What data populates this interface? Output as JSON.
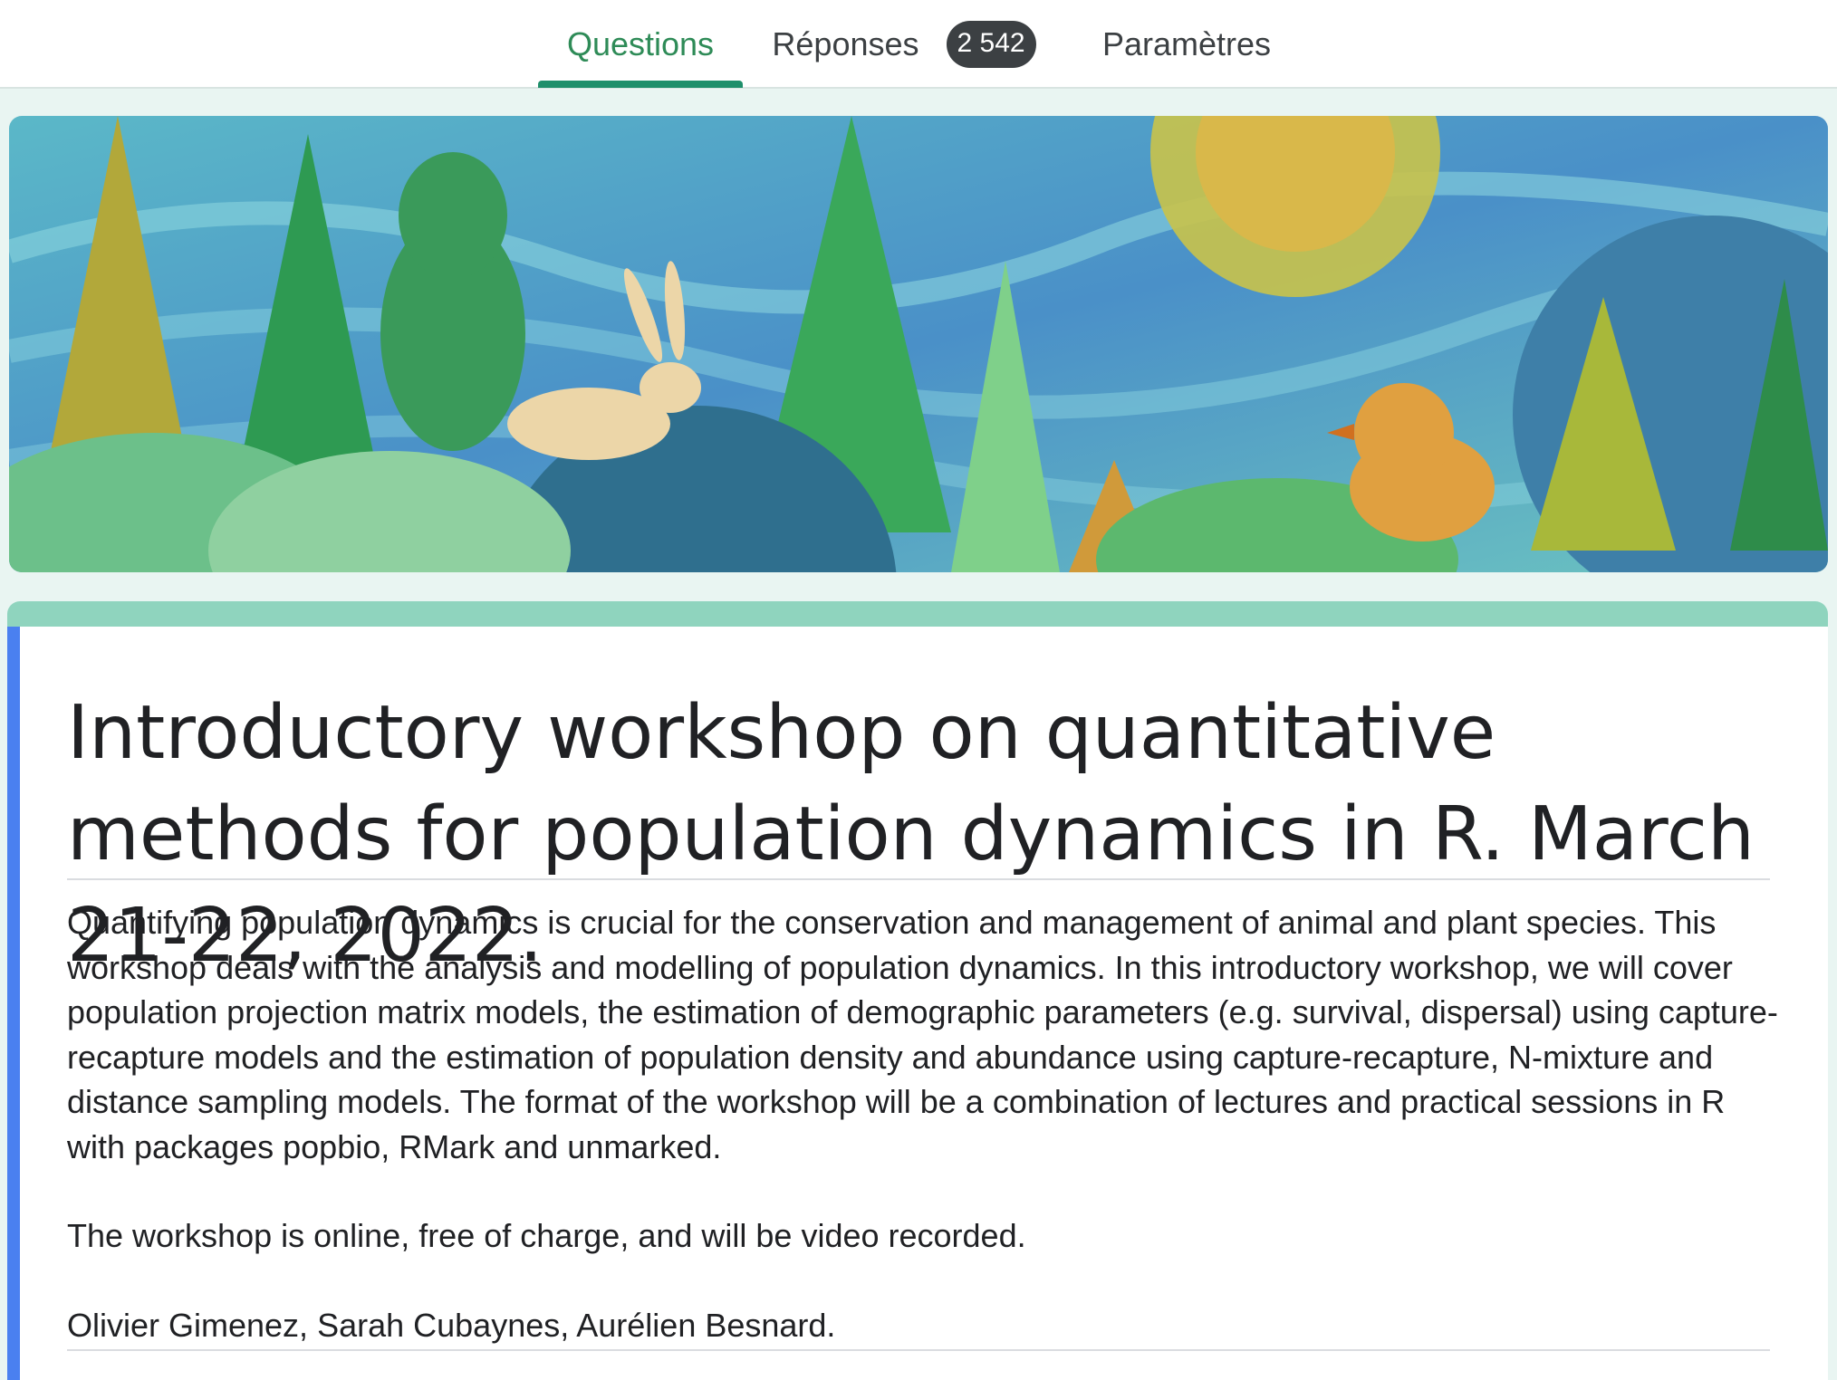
{
  "tabs": {
    "questions": "Questions",
    "reponses": "Réponses",
    "reponses_count": "2 542",
    "parametres": "Paramètres"
  },
  "form": {
    "title": "Introductory workshop on quantitative methods for population dynamics in R. March 21-22, 2022.",
    "description": [
      "Quantifying population dynamics is crucial for the conservation and management of animal and plant species. This workshop deals with the analysis and modelling of population dynamics. In this introductory workshop, we will cover population projection matrix models, the estimation of demographic parameters (e.g. survival, dispersal) using capture-recapture models and the estimation of population density and abundance using capture-recapture, N-mixture and distance sampling models. The format of the workshop will be a combination of lectures and practical sessions in R with packages popbio, RMark and unmarked.",
      "The workshop is online, free of charge, and will be video recorded.",
      "Olivier Gimenez, Sarah Cubaynes, Aurélien Besnard."
    ]
  },
  "colors": {
    "active_tab": "#2e8b57",
    "indicator": "#1f8f6b",
    "card_top": "#8fd4be",
    "card_left_bar": "#4a80f0"
  }
}
